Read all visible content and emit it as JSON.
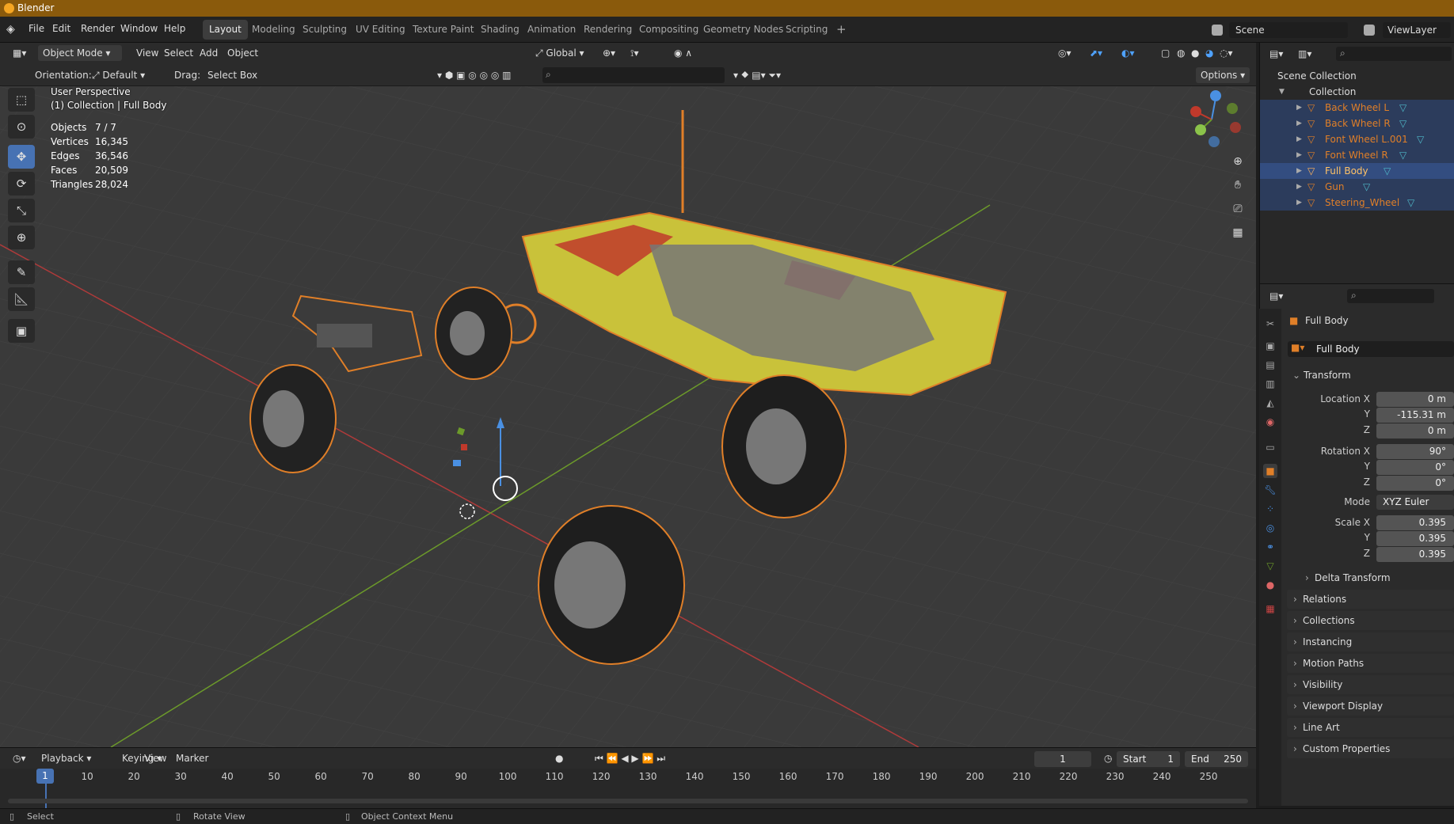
{
  "window": {
    "title": "Blender"
  },
  "menu": [
    "File",
    "Edit",
    "Render",
    "Window",
    "Help"
  ],
  "workspaces": [
    "Layout",
    "Modeling",
    "Sculpting",
    "UV Editing",
    "Texture Paint",
    "Shading",
    "Animation",
    "Rendering",
    "Compositing",
    "Geometry Nodes",
    "Scripting"
  ],
  "active_workspace": "Layout",
  "scene": {
    "name": "Scene",
    "viewlayer": "ViewLayer"
  },
  "header": {
    "mode": "Object Mode",
    "menus": [
      "View",
      "Select",
      "Add",
      "Object"
    ],
    "transform_orientation": "Global",
    "options": "Options",
    "orientation_label": "Orientation:",
    "orientation_value": "Default",
    "drag_label": "Drag:",
    "drag_value": "Select Box"
  },
  "viewport": {
    "perspective": "User Perspective",
    "context": "(1) Collection | Full Body",
    "stats": [
      {
        "label": "Objects",
        "value": "7 / 7"
      },
      {
        "label": "Vertices",
        "value": "16,345"
      },
      {
        "label": "Edges",
        "value": "36,546"
      },
      {
        "label": "Faces",
        "value": "20,509"
      },
      {
        "label": "Triangles",
        "value": "28,024"
      }
    ]
  },
  "outliner": {
    "scene_collection": "Scene Collection",
    "collection": "Collection",
    "objects": [
      "Back Wheel L",
      "Back Wheel R",
      "Font Wheel L.001",
      "Font Wheel R",
      "Full Body",
      "Gun",
      "Steering_Wheel"
    ],
    "active": "Full Body"
  },
  "properties": {
    "object_name": "Full Body",
    "data_name": "Full Body",
    "panel": "Transform",
    "location_x_label": "Location X",
    "rotation_x_label": "Rotation X",
    "scale_x_label": "Scale X",
    "y_label": "Y",
    "z_label": "Z",
    "mode_label": "Mode",
    "location": {
      "x": "0 m",
      "y": "-115.31 m",
      "z": "0 m"
    },
    "rotation": {
      "x": "90°",
      "y": "0°",
      "z": "0°"
    },
    "rotation_mode": "XYZ Euler",
    "scale": {
      "x": "0.395",
      "y": "0.395",
      "z": "0.395"
    },
    "delta": "Delta Transform",
    "sections": [
      "Relations",
      "Collections",
      "Instancing",
      "Motion Paths",
      "Visibility",
      "Viewport Display",
      "Line Art",
      "Custom Properties"
    ]
  },
  "timeline": {
    "menus": [
      "Playback",
      "Keying",
      "View",
      "Marker"
    ],
    "current_frame": "1",
    "start_label": "Start",
    "start": "1",
    "end_label": "End",
    "end": "250",
    "ticks": [
      "1",
      "10",
      "20",
      "30",
      "40",
      "50",
      "60",
      "70",
      "80",
      "90",
      "100",
      "110",
      "120",
      "130",
      "140",
      "150",
      "160",
      "170",
      "180",
      "190",
      "200",
      "210",
      "220",
      "230",
      "240",
      "250"
    ]
  },
  "statusbar": {
    "select": "Select",
    "rotate": "Rotate View",
    "context_menu": "Object Context Menu"
  },
  "colors": {
    "accent": "#4772b3",
    "selection_outline": "#e07f28",
    "title_bar": "#8a5a0c",
    "grid": "#3a3a3a"
  }
}
